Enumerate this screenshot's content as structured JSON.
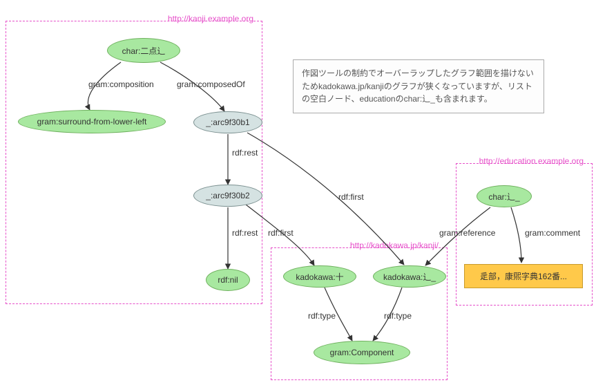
{
  "graphs": {
    "kanji": {
      "title": "http://kanji.example.org"
    },
    "kadokawa": {
      "title": "http://kadokawa.jp/kanji/"
    },
    "education": {
      "title": "http://education.example.org"
    }
  },
  "nodes": {
    "char_nitenshinnyo": "char:二点辶",
    "gram_surround_from_lower_left": "gram:surround-from-lower-left",
    "blank1": "_:arc9f30b1",
    "blank2": "_:arc9f30b2",
    "rdf_nil": "rdf:nil",
    "kadokawa_ju": "kadokawa:十",
    "kadokawa_shinnyo": "kadokawa:辶_",
    "gram_component": "gram:Component",
    "char_shinnyo": "char:辶_",
    "literal_comment": "辵部，康煕字典162番..."
  },
  "edges": {
    "gram_composition": "gram:composition",
    "gram_composedOf": "gram:composedOf",
    "rdf_rest_1": "rdf:rest",
    "rdf_rest_2": "rdf:rest",
    "rdf_first_1": "rdf:first",
    "rdf_first_2": "rdf:first",
    "rdf_type_1": "rdf:type",
    "rdf_type_2": "rdf:type",
    "gram_reference": "gram:reference",
    "gram_comment": "gram:comment"
  },
  "note": "作図ツールの制約でオーバーラップしたグラフ範囲を描けないためkadokawa.jp/kanjiのグラフが狭くなっていますが、リストの空白ノード、educationのchar:辶_も含まれます。"
}
